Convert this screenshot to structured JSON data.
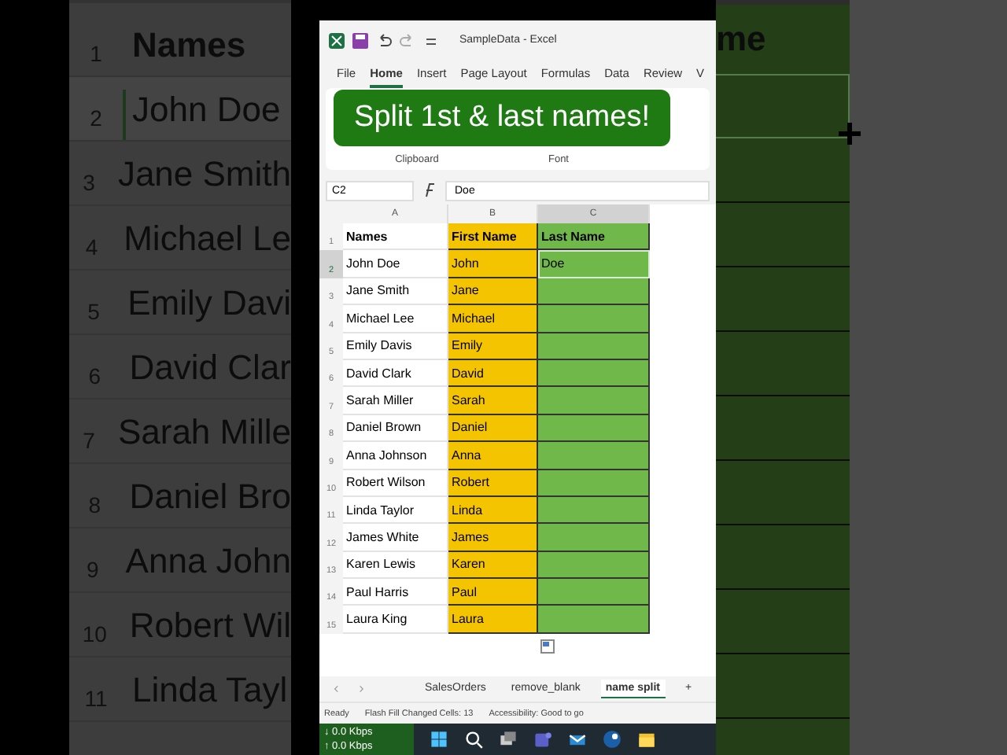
{
  "backdrop_left": {
    "rows": [
      {
        "number": "1",
        "name": "Names",
        "selected": false
      },
      {
        "number": "2",
        "name": "John Doe",
        "selected": true
      },
      {
        "number": "3",
        "name": "Jane Smith",
        "selected": false
      },
      {
        "number": "4",
        "name": "Michael Le",
        "selected": false
      },
      {
        "number": "5",
        "name": "Emily Davi",
        "selected": false
      },
      {
        "number": "6",
        "name": "David Clar",
        "selected": false
      },
      {
        "number": "7",
        "name": "Sarah Mille",
        "selected": false
      },
      {
        "number": "8",
        "name": "Daniel Bro",
        "selected": false
      },
      {
        "number": "9",
        "name": "Anna John",
        "selected": false
      },
      {
        "number": "10",
        "name": "Robert Wil",
        "selected": false
      },
      {
        "number": "11",
        "name": "Linda Tayl",
        "selected": false
      }
    ]
  },
  "backdrop_right": {
    "header": "me",
    "cells": [
      {
        "selected": true
      },
      {
        "selected": false
      },
      {
        "selected": false
      },
      {
        "selected": false
      },
      {
        "selected": false
      },
      {
        "selected": false
      },
      {
        "selected": false
      },
      {
        "selected": false
      },
      {
        "selected": false
      },
      {
        "selected": false
      }
    ]
  },
  "window": {
    "title": "SampleData - Excel"
  },
  "ribbon_tabs": [
    {
      "label": "File",
      "selected": false
    },
    {
      "label": "Home",
      "selected": true
    },
    {
      "label": "Insert",
      "selected": false
    },
    {
      "label": "Page Layout",
      "selected": false
    },
    {
      "label": "Formulas",
      "selected": false
    },
    {
      "label": "Data",
      "selected": false
    },
    {
      "label": "Review",
      "selected": false
    },
    {
      "label": "V",
      "selected": false
    }
  ],
  "banner": {
    "text": "Split 1st & last names!"
  },
  "ribbon_groups": [
    "Clipboard",
    "Font"
  ],
  "formula_bar": {
    "name_box": "C2",
    "value": "Doe"
  },
  "columns": [
    {
      "label": "A",
      "selected": false
    },
    {
      "label": "B",
      "selected": false,
      "color": "#f5c400"
    },
    {
      "label": "C",
      "selected": true,
      "color": "#70b84a"
    }
  ],
  "rows": [
    {
      "number": "1",
      "a": "Names",
      "b": "First Name",
      "c": "Last Name",
      "selected": false,
      "active": false
    },
    {
      "number": "2",
      "a": "John Doe",
      "b": "John",
      "c": "Doe",
      "selected": true,
      "active": true
    },
    {
      "number": "3",
      "a": "Jane Smith",
      "b": "Jane",
      "selected": false,
      "active": false
    },
    {
      "number": "4",
      "a": "Michael Lee",
      "b": "Michael",
      "selected": false,
      "active": false
    },
    {
      "number": "5",
      "a": "Emily Davis",
      "b": "Emily",
      "selected": false,
      "active": false
    },
    {
      "number": "6",
      "a": "David Clark",
      "b": "David",
      "selected": false,
      "active": false
    },
    {
      "number": "7",
      "a": "Sarah Miller",
      "b": "Sarah",
      "selected": false,
      "active": false
    },
    {
      "number": "8",
      "a": "Daniel Brown",
      "b": "Daniel",
      "selected": false,
      "active": false
    },
    {
      "number": "9",
      "a": "Anna Johnson",
      "b": "Anna",
      "selected": false,
      "active": false
    },
    {
      "number": "10",
      "a": "Robert Wilson",
      "b": "Robert",
      "selected": false,
      "active": false
    },
    {
      "number": "11",
      "a": "Linda Taylor",
      "b": "Linda",
      "selected": false,
      "active": false
    },
    {
      "number": "12",
      "a": "James White",
      "b": "James",
      "selected": false,
      "active": false
    },
    {
      "number": "13",
      "a": "Karen Lewis",
      "b": "Karen",
      "selected": false,
      "active": false
    },
    {
      "number": "14",
      "a": "Paul Harris",
      "b": "Paul",
      "selected": false,
      "active": false
    },
    {
      "number": "15",
      "a": "Laura King",
      "b": "Laura",
      "selected": false,
      "active": false
    }
  ],
  "sheet_tabs": [
    {
      "label": "SalesOrders",
      "selected": false
    },
    {
      "label": "remove_blank",
      "selected": false
    },
    {
      "label": "name split",
      "selected": true
    }
  ],
  "add_sheet": "+",
  "status_bar": [
    "Ready",
    "Flash Fill Changed Cells: 13",
    "Accessibility: Good to go"
  ],
  "taskbar": {
    "network": [
      "↓ 0.0 Kbps",
      "↑ 0.0 Kbps"
    ]
  }
}
